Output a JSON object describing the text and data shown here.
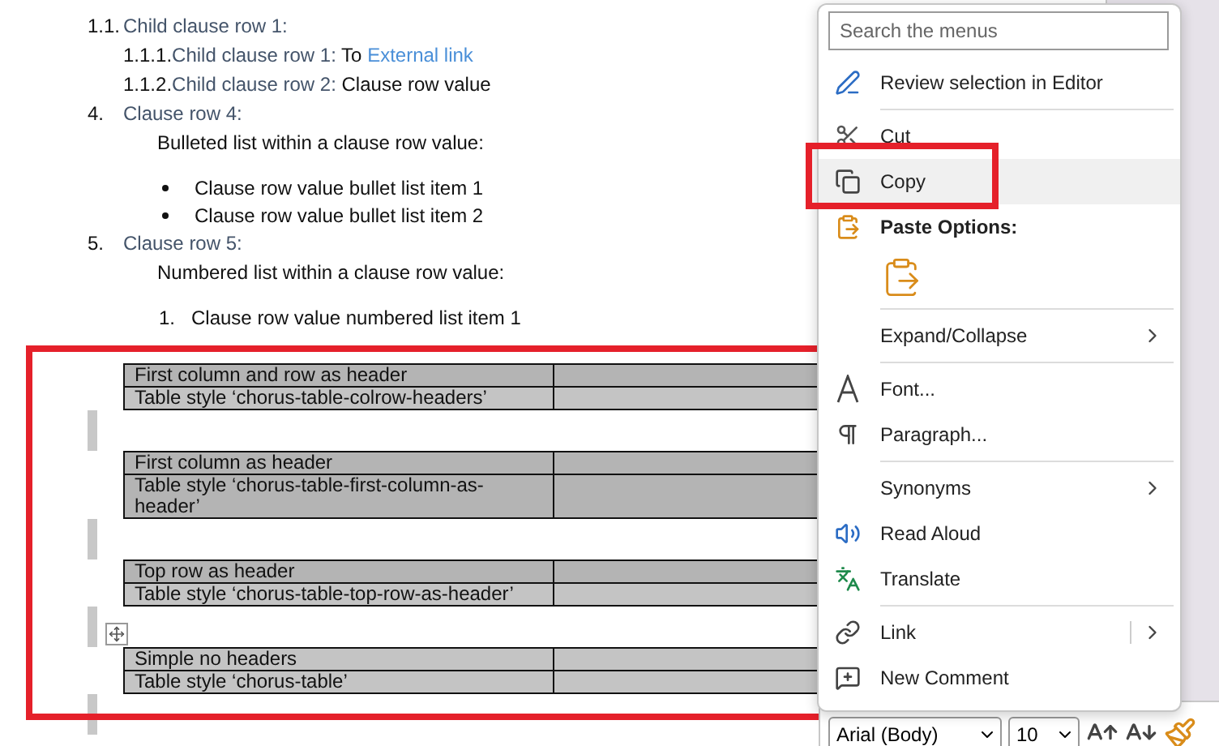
{
  "document": {
    "clauses": [
      {
        "children": [
          {
            "number": "1.1.",
            "title": "Child clause row 1:",
            "children": [
              {
                "number": "1.1.1.",
                "title": "Child clause row 1:",
                "value": "To ",
                "link": "External link"
              },
              {
                "number": "1.1.2.",
                "title": "Child clause row 2:",
                "value": "Clause row value"
              }
            ]
          }
        ]
      },
      {
        "number": "4.",
        "title": "Clause row 4:",
        "body": {
          "intro": "Bulleted list within a clause row value:",
          "kind": "bullet",
          "items": [
            {
              "text": "Clause row value bullet list item 1"
            },
            {
              "text": "Clause row value bullet list item 2"
            }
          ]
        }
      },
      {
        "number": "5.",
        "title": "Clause row 5:",
        "body": {
          "intro": "Numbered list within a clause row value:",
          "kind": "numbered",
          "items": [
            {
              "marker": "1.",
              "text": "Clause row value numbered list item 1"
            }
          ]
        }
      }
    ],
    "tables": [
      {
        "move_handle": false,
        "rows": [
          {
            "text": "First column and row as header",
            "header": true
          },
          {
            "text": "Table style ‘chorus-table-colrow-headers’",
            "header": false
          }
        ]
      },
      {
        "move_handle": false,
        "rows": [
          {
            "text": "First column as header",
            "header": true
          },
          {
            "text": "Table style ‘chorus-table-first-column-as-header’",
            "header": true
          }
        ]
      },
      {
        "move_handle": false,
        "rows": [
          {
            "text": "Top row as header",
            "header": true
          },
          {
            "text": "Table style ‘chorus-table-top-row-as-header’",
            "header": false
          }
        ]
      },
      {
        "move_handle": true,
        "rows": [
          {
            "text": "Simple no headers",
            "header": false
          },
          {
            "text": "Table style ‘chorus-table’",
            "header": false
          }
        ]
      }
    ]
  },
  "context_menu": {
    "search": {
      "placeholder": "Search the menus"
    },
    "items": [
      {
        "kind": "item",
        "label": "Review selection in Editor",
        "selected": false,
        "submenu": false
      },
      {
        "kind": "separator"
      },
      {
        "kind": "item",
        "label": "Cut",
        "selected": false,
        "submenu": false
      },
      {
        "kind": "item",
        "label": "Copy",
        "selected": true,
        "submenu": false
      },
      {
        "kind": "header",
        "label": "Paste Options:"
      },
      {
        "kind": "paste-options"
      },
      {
        "kind": "separator"
      },
      {
        "kind": "item",
        "label": "Expand/Collapse",
        "selected": false,
        "submenu": true
      },
      {
        "kind": "separator"
      },
      {
        "kind": "item",
        "label": "Font...",
        "selected": false,
        "submenu": false
      },
      {
        "kind": "item",
        "label": "Paragraph...",
        "selected": false,
        "submenu": false
      },
      {
        "kind": "separator"
      },
      {
        "kind": "item",
        "label": "Synonyms",
        "selected": false,
        "submenu": true
      },
      {
        "kind": "item",
        "label": "Read Aloud",
        "selected": false,
        "submenu": false
      },
      {
        "kind": "item",
        "label": "Translate",
        "selected": false,
        "submenu": false
      },
      {
        "kind": "separator"
      },
      {
        "kind": "item",
        "label": "Link",
        "selected": false,
        "submenu": true
      },
      {
        "kind": "item",
        "label": "New Comment",
        "selected": false,
        "submenu": false
      }
    ]
  },
  "mini_toolbar": {
    "font": "Arial (Body)",
    "size": "10"
  }
}
